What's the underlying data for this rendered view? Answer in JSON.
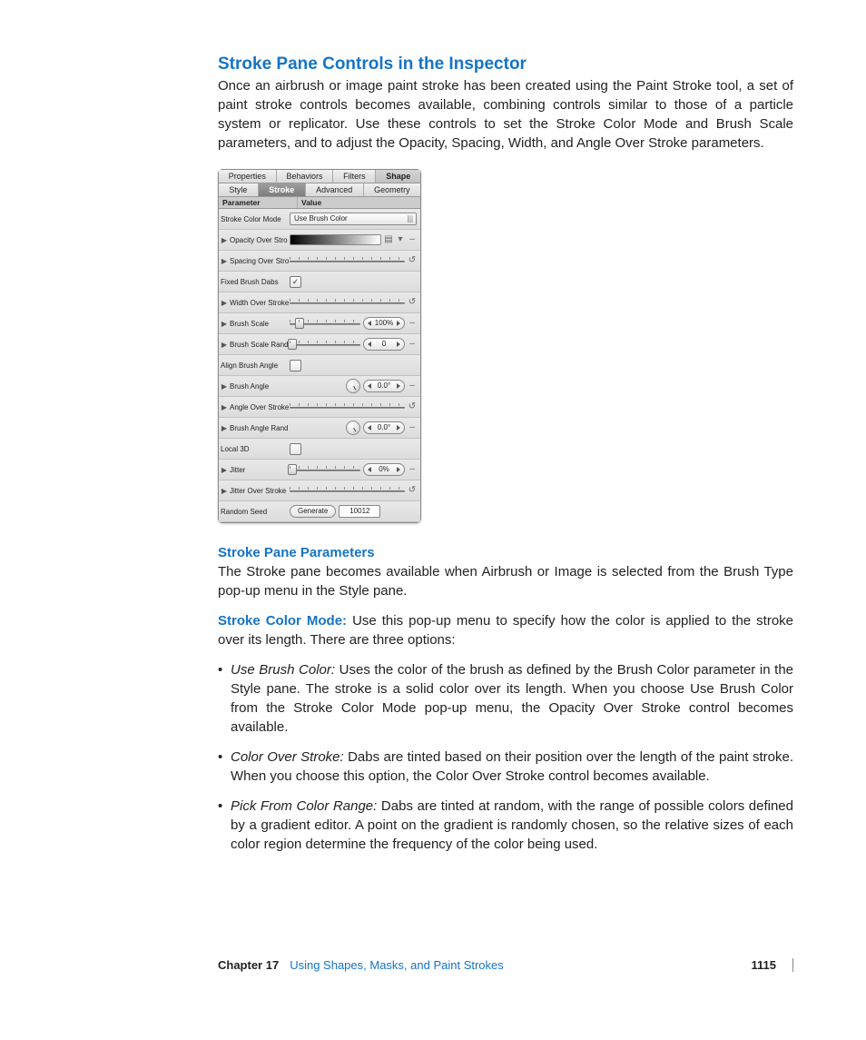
{
  "section_title": "Stroke Pane Controls in the Inspector",
  "intro_paragraph": "Once an airbrush or image paint stroke has been created using the Paint Stroke tool, a set of paint stroke controls becomes available, combining controls similar to those of a particle system or replicator. Use these controls to set the Stroke Color Mode and Brush Scale parameters, and to adjust the Opacity, Spacing, Width, and Angle Over Stroke parameters.",
  "inspector": {
    "top_tabs": [
      "Properties",
      "Behaviors",
      "Filters",
      "Shape"
    ],
    "top_active_index": 3,
    "sub_tabs": [
      "Style",
      "Stroke",
      "Advanced",
      "Geometry"
    ],
    "sub_active_index": 1,
    "headers": {
      "param": "Parameter",
      "value": "Value"
    },
    "rows": {
      "stroke_color_mode": {
        "label": "Stroke Color Mode",
        "value": "Use Brush Color"
      },
      "opacity_over_stroke": {
        "label": "Opacity Over Stro"
      },
      "spacing_over_stroke": {
        "label": "Spacing Over Stro"
      },
      "fixed_brush_dabs": {
        "label": "Fixed Brush Dabs",
        "checked": true
      },
      "width_over_stroke": {
        "label": "Width Over Stroke"
      },
      "brush_scale": {
        "label": "Brush Scale",
        "value": "100%"
      },
      "brush_scale_rand": {
        "label": "Brush Scale Rand",
        "value": "0"
      },
      "align_brush_angle": {
        "label": "Align Brush Angle",
        "checked": false
      },
      "brush_angle": {
        "label": "Brush Angle",
        "value": "0.0°"
      },
      "angle_over_stroke": {
        "label": "Angle Over Stroke"
      },
      "brush_angle_rand": {
        "label": "Brush Angle Rand",
        "value": "0.0°"
      },
      "local_3d": {
        "label": "Local 3D",
        "checked": false
      },
      "jitter": {
        "label": "Jitter",
        "value": "0%"
      },
      "jitter_over_stroke": {
        "label": "Jitter Over Stroke"
      },
      "random_seed": {
        "label": "Random Seed",
        "button": "Generate",
        "value": "10012"
      }
    }
  },
  "subsection_title": "Stroke Pane Parameters",
  "stroke_pane_intro": "The Stroke pane becomes available when Airbrush or Image is selected from the Brush Type pop-up menu in the Style pane.",
  "stroke_color_mode_term": "Stroke Color Mode:",
  "stroke_color_mode_body": "Use this pop-up menu to specify how the color is applied to the stroke over its length. There are three options:",
  "options": [
    {
      "name": "Use Brush Color:",
      "body": "Uses the color of the brush as defined by the Brush Color parameter in the Style pane. The stroke is a solid color over its length. When you choose Use Brush Color from the Stroke Color Mode pop-up menu, the Opacity Over Stroke control becomes available."
    },
    {
      "name": "Color Over Stroke:",
      "body": "Dabs are tinted based on their position over the length of the paint stroke. When you choose this option, the Color Over Stroke control becomes available."
    },
    {
      "name": "Pick From Color Range:",
      "body": "Dabs are tinted at random, with the range of possible colors defined by a gradient editor. A point on the gradient is randomly chosen, so the relative sizes of each color region determine the frequency of the color being used."
    }
  ],
  "footer": {
    "chapter": "Chapter 17",
    "title": "Using Shapes, Masks, and Paint Strokes",
    "page": "1115"
  }
}
